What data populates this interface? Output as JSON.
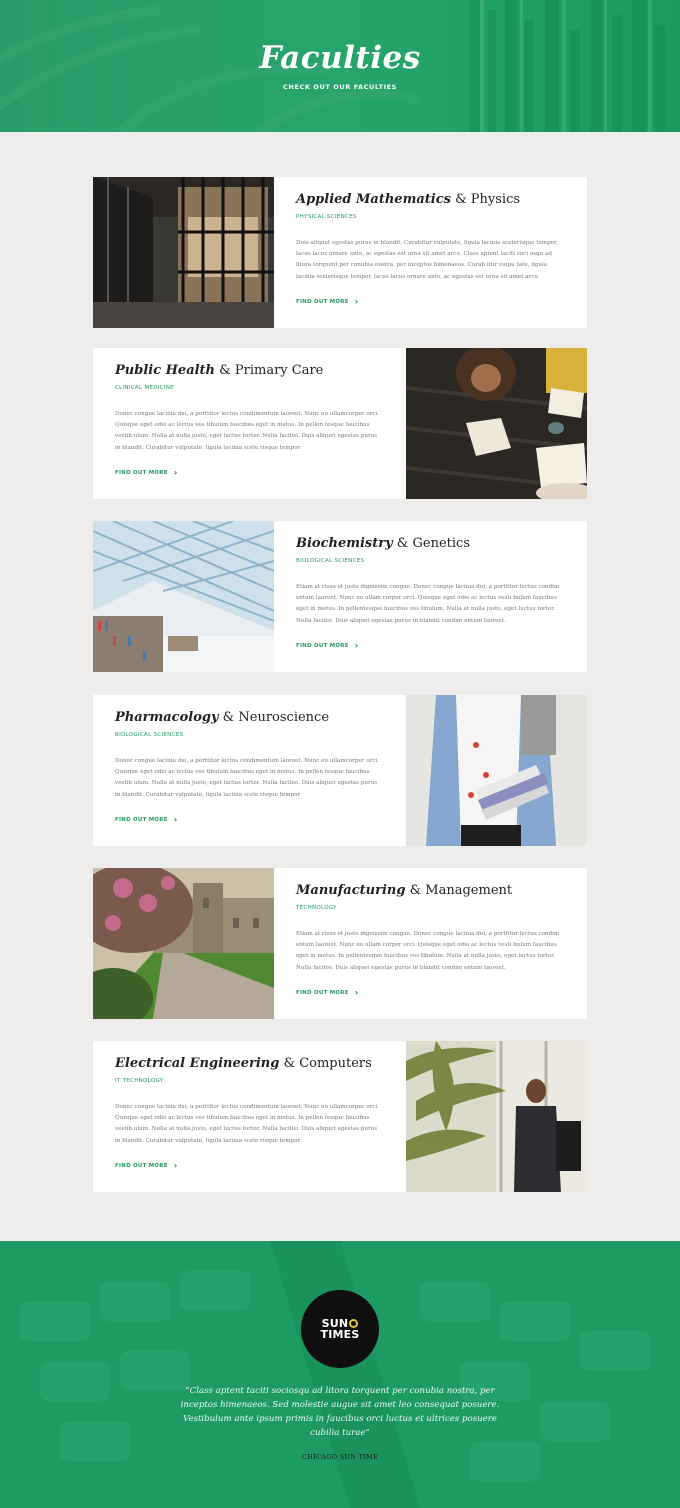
{
  "hero": {
    "title": "Faculties",
    "subtitle": "CHECK OUT OUR FACULTIES"
  },
  "colors": {
    "accent_green": "#1e9a62",
    "background": "#eeedeb",
    "card": "#ffffff",
    "logo_bg": "#0f0f0f",
    "logo_sun": "#e8c23a"
  },
  "faculties": [
    {
      "title_bold": "Applied Mathematics",
      "amp": "&",
      "title_rest": "Physics",
      "category": "PHYSICAL SCIENCES",
      "body": "Duis aliquet egestas purus in blandit. Curabitur vulputate, ligula lacinia scelerisque tempor, lacus lacus ornare ante, ac egestas est urna sit amet arcu. Class aptent taciti soci osqu ad litora torquent per conubia nostra, per inceptos himenaeos. Curab itur vulpu tate, ligula lacinia scelerisque tempor, lacus lacus ornare ante, ac egestas est urna sit amet arcu",
      "link": "FIND OUT MORE",
      "image": "library-interior-photo"
    },
    {
      "title_bold": "Public Health",
      "amp": "&",
      "title_rest": "Primary Care",
      "category": "CLINICAL MEDICINE",
      "body": "Donec congue lacinia dui, a porttitor lectus condimentum laoreet. Nunc eu ullamcorper orci. Quisque eget odio ac lectus ves tibulum faucibus eget in metus. In pellen tesque faucibus vestib ulum. Nulla at nulla justo, eget luctus tortor. Nulla facilisi. Duis aliquet egestas purus in blandit. Curabitur vulputate, ligula lacinia scele risque tempor",
      "link": "FIND OUT MORE",
      "image": "students-reading-photo"
    },
    {
      "title_bold": "Biochemistry",
      "amp": "&",
      "title_rest": "Genetics",
      "category": "BIOLOGICAL SCIENCES",
      "body": "Etiam at risus et justo dignissim congue. Donec congue lacinia dui, a porttitor lectus condim entum laoreet. Nunc eu ullam corper orci. Quisque eget odio ac lectus vesti bulum faucibus eget in metus. In pellentesque faucibus ves tibulum. Nulla at nulla justo, eget luctus tortor. Nulla facilisi. Duis aliquet egestas purus in blandit condim entum laoreet.",
      "link": "FIND OUT MORE",
      "image": "modern-library-photo"
    },
    {
      "title_bold": "Pharmacology",
      "amp": "&",
      "title_rest": "Neuroscience",
      "category": "BIOLOGICAL SCIENCES",
      "body": "Donec congue lacinia dui, a porttitor lectus condimentum laoreet. Nunc eu ullamcorper orci. Quisque eget odio ac lectus ves tibulum faucibus eget in metus. In pellen tesque faucibus vestib ulum. Nulla at nulla justo, eget luctus tortor. Nulla facilisi. Duis aliquet egestas purus in blandit. Curabitur vulputate, ligula lacinia scele risque tempor",
      "link": "FIND OUT MORE",
      "image": "student-with-books-photo"
    },
    {
      "title_bold": "Manufacturing",
      "amp": "&",
      "title_rest": "Management",
      "category": "TECHNOLOGY",
      "body": "Etiam at risus et justo dignissim congue. Donec congue lacinia dui, a porttitor lectus condim entum laoreet. Nunc eu ullam corper orci. Quisque eget odio ac lectus vesti bulum faucibus eget in metus. In pellentesque faucibus ves tibulum. Nulla at nulla justo, eget luctus tortor. Nulla facilisi. Duis aliquet egestas purus in blandit condim entum laoreet.",
      "link": "FIND OUT MORE",
      "image": "campus-path-photo"
    },
    {
      "title_bold": "Electrical Engineering",
      "amp": "&",
      "title_rest": "Computers",
      "category": "IT TECHNOLOGY",
      "body": "Donec congue lacinia dui, a porttitor lectus condimentum laoreet. Nunc eu ullamcorper orci. Quisque eget odio ac lectus ves tibulum faucibus eget in metus. In pellen tesque faucibus vestib ulum. Nulla at nulla justo, eget luctus tortor. Nulla facilisi. Duis aliquet egestas purus in blandit. Curabitur vulputate, ligula lacinia scele risque tempor",
      "link": "FIND OUT MORE",
      "image": "student-with-phone-photo"
    }
  ],
  "footer": {
    "logo_line1": "SUN",
    "logo_line2": "TIMES",
    "quote": "“Class aptent taciti sociosqu ad litora torquent per conubia nostra, per inceptos himenaeos. Sed molestie augue sit amet leo consequat posuere. Vestibulum ante ipsum primis in faucibus orci luctus et ultrices posuere cubilia turae”",
    "attribution": "CHICAGO SUN TIME"
  }
}
